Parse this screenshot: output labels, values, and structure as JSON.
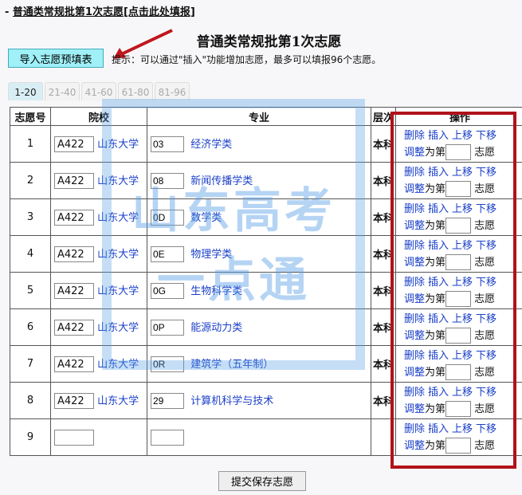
{
  "header": {
    "prefix": "- ",
    "link": "普通类常规批第1次志愿[点击此处填报]"
  },
  "title": "普通类常规批第1次志愿",
  "import_button": "导入志愿预填表",
  "hint": "提示：可以通过\"插入\"功能增加志愿，最多可以填报96个志愿。",
  "tabs": [
    "1-20",
    "21-40",
    "41-60",
    "61-80",
    "81-96"
  ],
  "columns": [
    "志愿号",
    "院校",
    "专业",
    "层次",
    "操作"
  ],
  "ops": {
    "delete": "删除",
    "insert": "插入",
    "up": "上移",
    "down": "下移",
    "adjust": "调整",
    "to": "为第",
    "suffix": "志愿"
  },
  "rows": [
    {
      "no": "1",
      "code": "A422",
      "school": "山东大学",
      "mcode": "03",
      "major": "经济学类",
      "level": "本科"
    },
    {
      "no": "2",
      "code": "A422",
      "school": "山东大学",
      "mcode": "08",
      "major": "新闻传播学类",
      "level": "本科"
    },
    {
      "no": "3",
      "code": "A422",
      "school": "山东大学",
      "mcode": "0D",
      "major": "数学类",
      "level": "本科"
    },
    {
      "no": "4",
      "code": "A422",
      "school": "山东大学",
      "mcode": "0E",
      "major": "物理学类",
      "level": "本科"
    },
    {
      "no": "5",
      "code": "A422",
      "school": "山东大学",
      "mcode": "0G",
      "major": "生物科学类",
      "level": "本科"
    },
    {
      "no": "6",
      "code": "A422",
      "school": "山东大学",
      "mcode": "0P",
      "major": "能源动力类",
      "level": "本科"
    },
    {
      "no": "7",
      "code": "A422",
      "school": "山东大学",
      "mcode": "0R",
      "major": "建筑学（五年制）",
      "level": "本科"
    },
    {
      "no": "8",
      "code": "A422",
      "school": "山东大学",
      "mcode": "29",
      "major": "计算机科学与技术",
      "level": "本科"
    },
    {
      "no": "9",
      "code": "",
      "school": "",
      "mcode": "",
      "major": "",
      "level": ""
    }
  ],
  "watermark": "山东高考一点通",
  "submit": "提交保存志愿"
}
